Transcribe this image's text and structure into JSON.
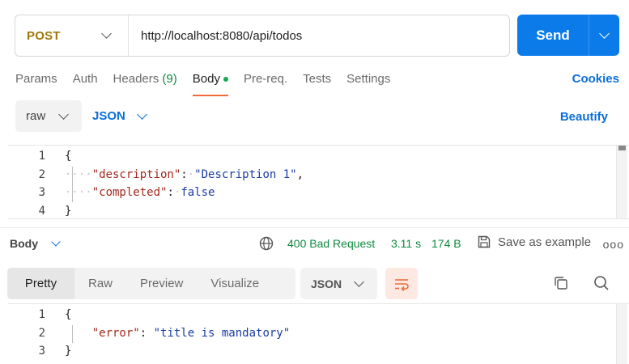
{
  "request": {
    "method": "POST",
    "url": "http://localhost:8080/api/todos",
    "send_label": "Send"
  },
  "request_tabs": {
    "params": "Params",
    "auth": "Auth",
    "headers": "Headers",
    "headers_count": "(9)",
    "body": "Body",
    "prereq": "Pre-req.",
    "tests": "Tests",
    "settings": "Settings",
    "cookies": "Cookies"
  },
  "body_options": {
    "mode": "raw",
    "language": "JSON",
    "beautify": "Beautify"
  },
  "request_body": {
    "line_numbers": [
      "1",
      "2",
      "3",
      "4"
    ],
    "open": "{",
    "key1": "\"description\"",
    "val1": "\"Description 1\"",
    "key2": "\"completed\"",
    "val2": "false",
    "close": "}"
  },
  "response": {
    "section_label": "Body",
    "status": "400 Bad Request",
    "time": "3.11 s",
    "size": "174 B",
    "save_example": "Save as example",
    "more": "ooo"
  },
  "response_tabs": {
    "pretty": "Pretty",
    "raw": "Raw",
    "preview": "Preview",
    "visualize": "Visualize",
    "format": "JSON"
  },
  "response_body": {
    "line_numbers": [
      "1",
      "2",
      "3"
    ],
    "open": "{",
    "key1": "\"error\"",
    "val1": "\"title is mandatory\"",
    "close": "}"
  },
  "colors": {
    "accent": "#0b7bea",
    "active_tab_underline": "#f26b3a",
    "status_green": "#0f8a3f",
    "method_post": "#a0770a"
  }
}
